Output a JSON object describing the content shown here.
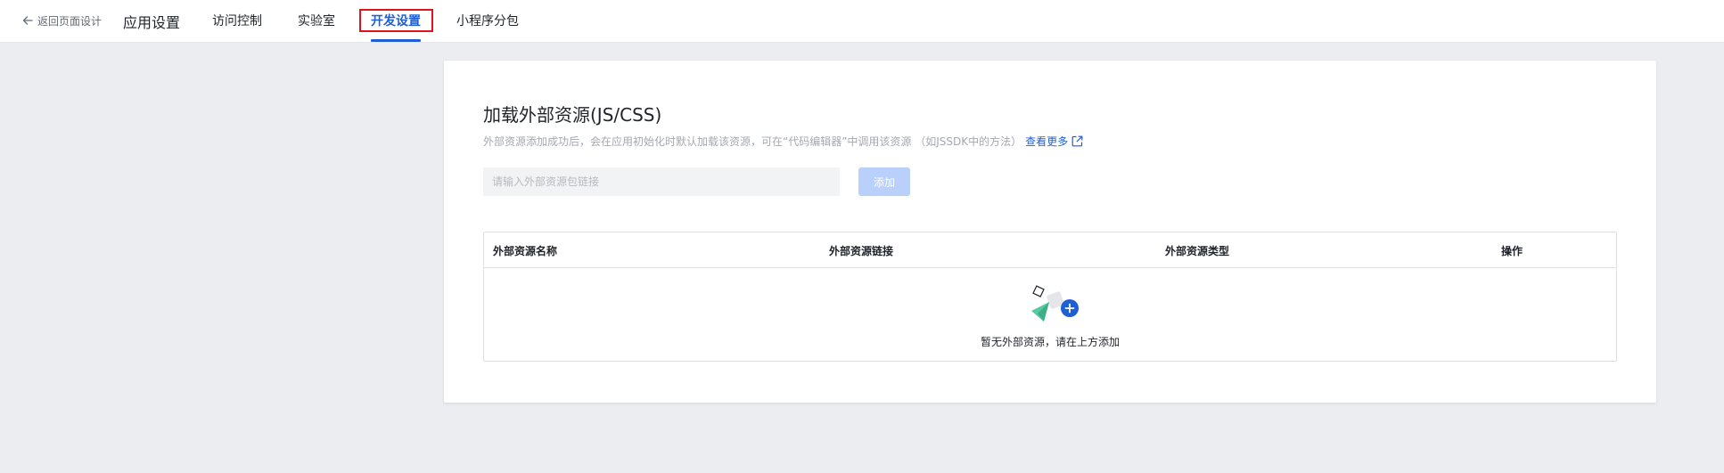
{
  "header": {
    "back_label": "返回页面设计",
    "app_title": "应用设置",
    "tabs": [
      {
        "label": "访问控制"
      },
      {
        "label": "实验室"
      },
      {
        "label": "开发设置"
      },
      {
        "label": "小程序分包"
      }
    ],
    "active_tab": "开发设置"
  },
  "section": {
    "title": "加载外部资源(JS/CSS)",
    "description": "外部资源添加成功后，会在应用初始化时默认加载该资源，可在“代码编辑器”中调用该资源 （如JSSDK中的方法）",
    "more_link": "查看更多",
    "input": {
      "placeholder": "请输入外部资源包链接",
      "value": ""
    },
    "add_button": "添加"
  },
  "table": {
    "columns": [
      "外部资源名称",
      "外部资源链接",
      "外部资源类型",
      "操作"
    ],
    "rows": [],
    "empty_text": "暂无外部资源，请在上方添加"
  },
  "colors": {
    "accent": "#1f5fd6",
    "highlight_border": "#e0121c",
    "disabled_button": "#b9d0fa",
    "page_bg": "#ebedf1"
  },
  "icons": {
    "back": "arrow-left-icon",
    "external_link": "external-link-icon",
    "empty_state": "empty-state-illustration"
  }
}
